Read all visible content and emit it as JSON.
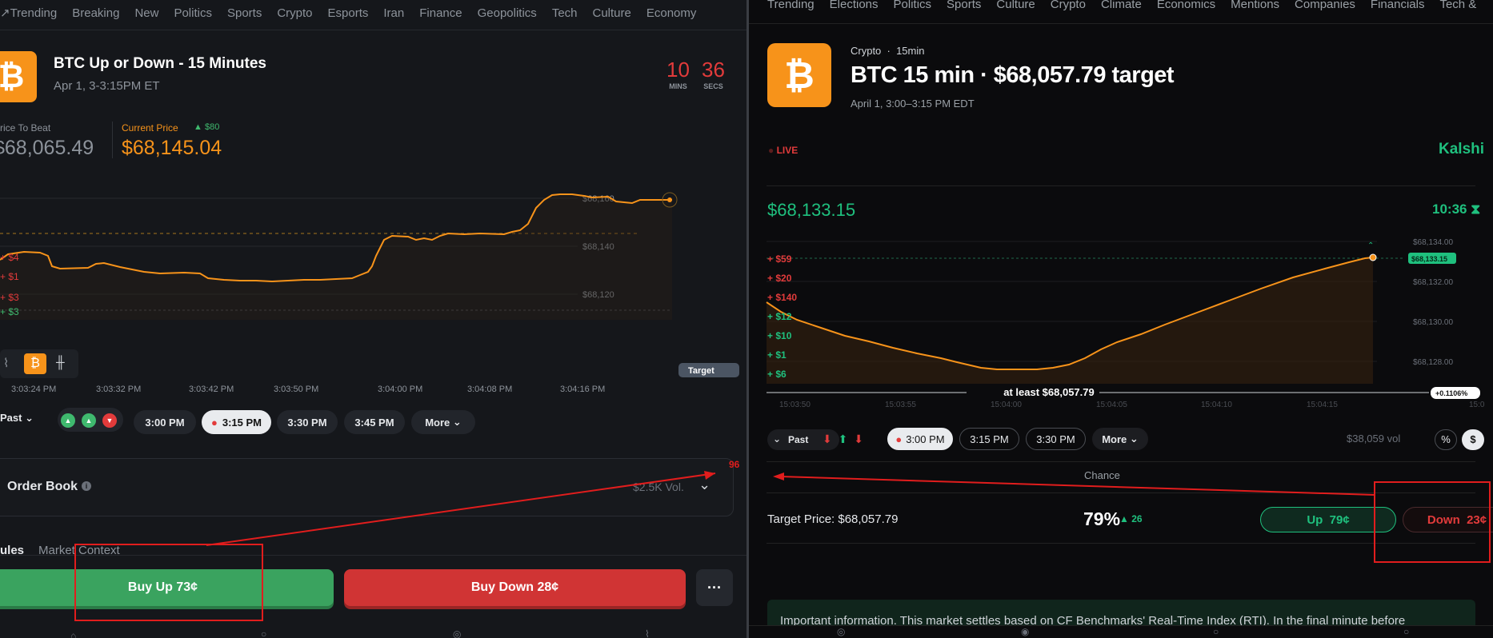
{
  "left": {
    "nav": [
      "Trending",
      "Breaking",
      "New",
      "Politics",
      "Sports",
      "Crypto",
      "Esports",
      "Iran",
      "Finance",
      "Geopolitics",
      "Tech",
      "Culture",
      "Economy"
    ],
    "title": "BTC Up or Down - 15 Minutes",
    "subtitle": "Apr 1, 3-3:15PM ET",
    "timer": {
      "mins": "10",
      "mins_label": "MINS",
      "secs": "36",
      "secs_label": "SECS"
    },
    "price_to_beat_label": "rice To Beat",
    "price_to_beat": "$68,065.49",
    "current_price_label": "Current Price",
    "current_delta": "$80",
    "current_price": "$68,145.04",
    "y_ticks": [
      "$68,160",
      "$68,140",
      "$68,120"
    ],
    "x_ticks": [
      "3:03:24 PM",
      "3:03:32 PM",
      "3:03:42 PM",
      "3:03:50 PM",
      "3:04:00 PM",
      "3:04:08 PM",
      "3:04:16 PM"
    ],
    "trade_flashes": [
      "+ $4",
      "+ $1",
      "+ $3",
      "+ $3"
    ],
    "target_badge": "Target",
    "time_pills": [
      "3:00 PM",
      "3:15 PM",
      "3:30 PM",
      "3:45 PM"
    ],
    "past_label": "Past",
    "more_label": "More",
    "order_book_label": "Order Book",
    "volume": "$2.5K Vol.",
    "tabs": [
      "ules",
      "Market Context"
    ],
    "buy_up": "Buy Up 73¢",
    "buy_down": "Buy Down 28¢",
    "more_dots": "···",
    "annotation_number": "96",
    "chart_data": {
      "type": "line",
      "x": [
        "3:03:24 PM",
        "3:03:32 PM",
        "3:03:42 PM",
        "3:03:50 PM",
        "3:04:00 PM",
        "3:04:08 PM",
        "3:04:16 PM"
      ],
      "series": [
        {
          "values": [
            68124,
            68118,
            68113,
            68112,
            68136,
            68140,
            68146
          ]
        }
      ],
      "reference_line": 68065.49,
      "ylim": [
        68100,
        68165
      ]
    }
  },
  "right": {
    "nav": [
      "Trending",
      "Elections",
      "Politics",
      "Sports",
      "Culture",
      "Crypto",
      "Climate",
      "Economics",
      "Mentions",
      "Companies",
      "Financials",
      "Tech &"
    ],
    "category": "Crypto",
    "interval": "15min",
    "title": "BTC 15 min · $68,057.79 target",
    "subtitle": "April 1, 3:00–3:15 PM EDT",
    "live_label": "LIVE",
    "brand": "Kalshi",
    "price": "$68,133.15",
    "timer": "10:36",
    "y_ticks": [
      "$68,134.00",
      "$68,132.00",
      "$68,130.00",
      "$68,128.00"
    ],
    "price_tag": "$68,133.15",
    "x_ticks": [
      "15:03:50",
      "15:03:55",
      "15:04:00",
      "15:04:05",
      "15:04:10",
      "15:04:15",
      "15:0"
    ],
    "trade_flashes": [
      "+ $59",
      "+ $20",
      "+ $140",
      "+ $12",
      "+ $10",
      "+ $1",
      "+ $6"
    ],
    "target_line_label": "at least $68,057.79",
    "pct_badge": "+0.1106%",
    "past_label": "Past",
    "time_pills": [
      "3:00 PM",
      "3:15 PM",
      "3:30 PM"
    ],
    "more_label": "More",
    "volume": "$38,059 vol",
    "pct_toggle": "%",
    "usd_toggle": "$",
    "chance_label": "Chance",
    "target_price": "Target Price: $68,057.79",
    "chance_value": "79%",
    "chance_delta": "26",
    "up_button": "Up  79¢",
    "down_button": "Down  23¢",
    "info_text": "Important information. This market settles based on CF Benchmarks' Real-Time Index (RTI). In the final minute before",
    "chart_data": {
      "type": "area",
      "x": [
        "15:03:50",
        "15:03:55",
        "15:04:00",
        "15:04:05",
        "15:04:10",
        "15:04:15"
      ],
      "series": [
        {
          "values": [
            68130.8,
            68128.4,
            68127.8,
            68128.5,
            68130.5,
            68132.2,
            68133.15
          ]
        }
      ],
      "ylim": [
        68127,
        68134.5
      ]
    }
  }
}
